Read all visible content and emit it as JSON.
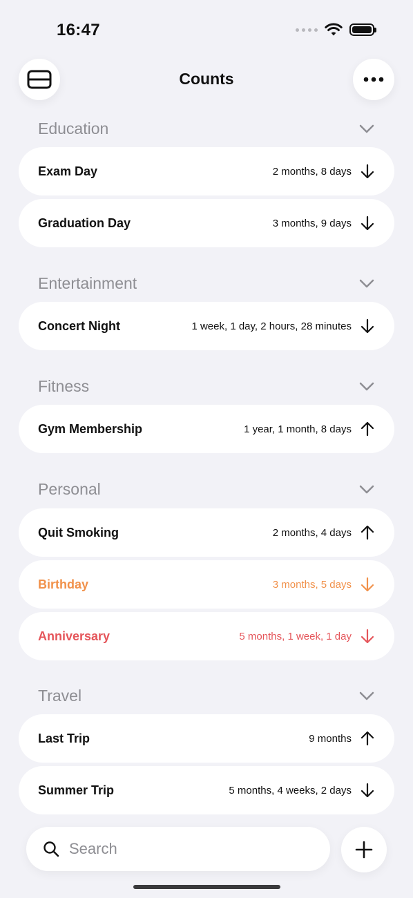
{
  "status_bar": {
    "time": "16:47"
  },
  "header": {
    "title": "Counts"
  },
  "sections": [
    {
      "title": "Education",
      "items": [
        {
          "title": "Exam Day",
          "value": "2 months, 8 days",
          "direction": "down",
          "color": "#111111"
        },
        {
          "title": "Graduation Day",
          "value": "3 months, 9 days",
          "direction": "down",
          "color": "#111111"
        }
      ]
    },
    {
      "title": "Entertainment",
      "items": [
        {
          "title": "Concert Night",
          "value": "1 week, 1 day, 2 hours, 28 minutes",
          "direction": "down",
          "color": "#111111"
        }
      ]
    },
    {
      "title": "Fitness",
      "items": [
        {
          "title": "Gym Membership",
          "value": "1 year, 1 month, 8 days",
          "direction": "up",
          "color": "#111111"
        }
      ]
    },
    {
      "title": "Personal",
      "items": [
        {
          "title": "Quit Smoking",
          "value": "2 months, 4 days",
          "direction": "up",
          "color": "#111111"
        },
        {
          "title": "Birthday",
          "value": "3 months, 5 days",
          "direction": "down",
          "color": "#f1914a"
        },
        {
          "title": "Anniversary",
          "value": "5 months, 1 week, 1 day",
          "direction": "down",
          "color": "#e5555a"
        }
      ]
    },
    {
      "title": "Travel",
      "items": [
        {
          "title": "Last Trip",
          "value": "9 months",
          "direction": "up",
          "color": "#111111"
        },
        {
          "title": "Summer Trip",
          "value": "5 months, 4 weeks, 2 days",
          "direction": "down",
          "color": "#111111"
        }
      ]
    }
  ],
  "search": {
    "placeholder": "Search"
  }
}
